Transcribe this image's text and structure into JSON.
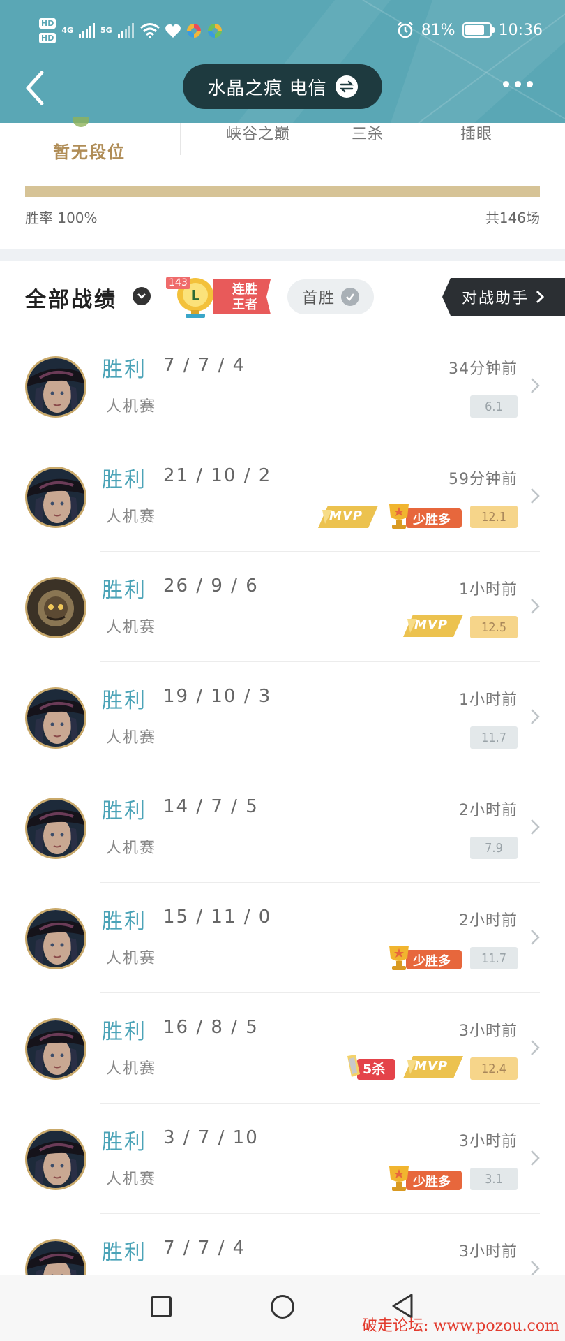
{
  "status_bar": {
    "hd_top": "HD",
    "hd_bottom": "HD",
    "net1": "4G",
    "net2": "5G",
    "battery_percent_label": "81%",
    "battery_level": 0.81,
    "time": "10:36"
  },
  "header": {
    "title": "水晶之痕 电信",
    "icons": {
      "back": "chevron-left-icon",
      "swap": "swap-icon",
      "more": "more-dots-icon"
    }
  },
  "profile": {
    "rank_label": "暂无段位",
    "stats": [
      "峡谷之巅",
      "三杀",
      "插眼"
    ],
    "win_rate_label": "胜率 100%",
    "win_rate": 1.0,
    "total_games_label": "共146场"
  },
  "filter": {
    "title": "全部战绩",
    "streak_count": "143",
    "streak_label_line1": "连胜",
    "streak_label_line2": "王者",
    "first_win_label": "首胜",
    "assistant_label": "对战助手"
  },
  "colors": {
    "header_bg": "#5aa7b5",
    "win_text": "#4ba3b7",
    "gold": "#d6c396",
    "score_gold_bg": "#f6d58a",
    "score_gray_bg": "#e3e8ea"
  },
  "matches": [
    {
      "result": "胜利",
      "kda": "7 / 7 / 4",
      "time": "34分钟前",
      "mode": "人机赛",
      "score": "6.1",
      "score_style": "gray",
      "avatar": "hero-a",
      "badges": []
    },
    {
      "result": "胜利",
      "kda": "21 / 10 / 2",
      "time": "59分钟前",
      "mode": "人机赛",
      "score": "12.1",
      "score_style": "gold",
      "avatar": "hero-a",
      "badges": [
        "mvp",
        "sheng"
      ]
    },
    {
      "result": "胜利",
      "kda": "26 / 9 / 6",
      "time": "1小时前",
      "mode": "人机赛",
      "score": "12.5",
      "score_style": "gold",
      "avatar": "hero-b",
      "badges": [
        "mvp"
      ]
    },
    {
      "result": "胜利",
      "kda": "19 / 10 / 3",
      "time": "1小时前",
      "mode": "人机赛",
      "score": "11.7",
      "score_style": "gray",
      "avatar": "hero-a",
      "badges": []
    },
    {
      "result": "胜利",
      "kda": "14 / 7 / 5",
      "time": "2小时前",
      "mode": "人机赛",
      "score": "7.9",
      "score_style": "gray",
      "avatar": "hero-a",
      "badges": []
    },
    {
      "result": "胜利",
      "kda": "15 / 11 / 0",
      "time": "2小时前",
      "mode": "人机赛",
      "score": "11.7",
      "score_style": "gray",
      "avatar": "hero-a",
      "badges": [
        "sheng"
      ]
    },
    {
      "result": "胜利",
      "kda": "16 / 8 / 5",
      "time": "3小时前",
      "mode": "人机赛",
      "score": "12.4",
      "score_style": "gold",
      "avatar": "hero-a",
      "badges": [
        "penta",
        "mvp"
      ]
    },
    {
      "result": "胜利",
      "kda": "3 / 7 / 10",
      "time": "3小时前",
      "mode": "人机赛",
      "score": "3.1",
      "score_style": "gray",
      "avatar": "hero-a",
      "badges": [
        "sheng"
      ]
    },
    {
      "result": "胜利",
      "kda": "7 / 7 / 4",
      "time": "3小时前",
      "mode": "",
      "score": "",
      "score_style": "",
      "avatar": "hero-a",
      "badges": []
    }
  ],
  "badge_labels": {
    "mvp": "MVP",
    "sheng": "少胜多",
    "penta": "5杀"
  },
  "watermark": "破走论坛: www.pozou.com"
}
